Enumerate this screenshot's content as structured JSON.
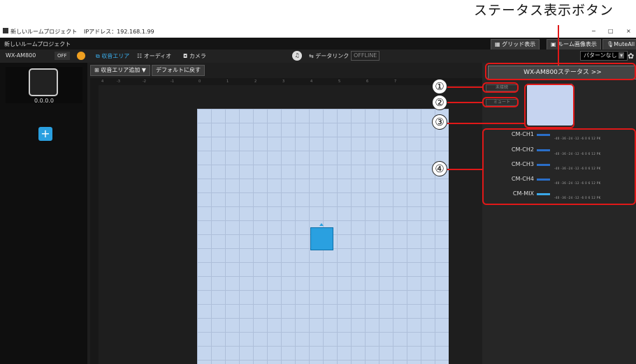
{
  "callout": {
    "title": "ステータス表示ボタン"
  },
  "window": {
    "title": "新しいルームプロジェクト",
    "ip": "IPアドレス：192.168.1.99",
    "controls": [
      "−",
      "□",
      "×"
    ]
  },
  "subbar": {
    "project": "新しいルームプロジェクト",
    "grid": "グリッド表示",
    "room_image": "ルーム画像表示",
    "mute_all": "MuteAll"
  },
  "toolbar": {
    "device": "WX-AM800",
    "off": "OFF",
    "tabs": [
      "収音エリア",
      "オーディオ",
      "カメラ"
    ],
    "data_link": "データリンク",
    "offline": "OFFLINE",
    "pattern": "パターンなし"
  },
  "center": {
    "add_area": "収音エリア追加",
    "default": "デフォルトに戻す",
    "ruler": [
      "4",
      "-3",
      "-2",
      "-1",
      "0",
      "1",
      "2",
      "3",
      "4",
      "5",
      "6",
      "7"
    ]
  },
  "left": {
    "ip": "0.0.0.0",
    "plus": "+"
  },
  "right": {
    "status_button": "WX-AM800ステータス >>",
    "btn1": "未接続",
    "btn2": "ミュート",
    "meters": [
      "CM-CH1",
      "CM-CH2",
      "CM-CH3",
      "CM-CH4",
      "CM-MIX"
    ],
    "scale": "-40   -36   -24   -12  -6  0   6   12  PK"
  },
  "markers": [
    "①",
    "②",
    "③",
    "④"
  ],
  "colors": {
    "accent": "#2aa0e0",
    "callout": "#e01818",
    "canvas": "#c5d6ee"
  }
}
